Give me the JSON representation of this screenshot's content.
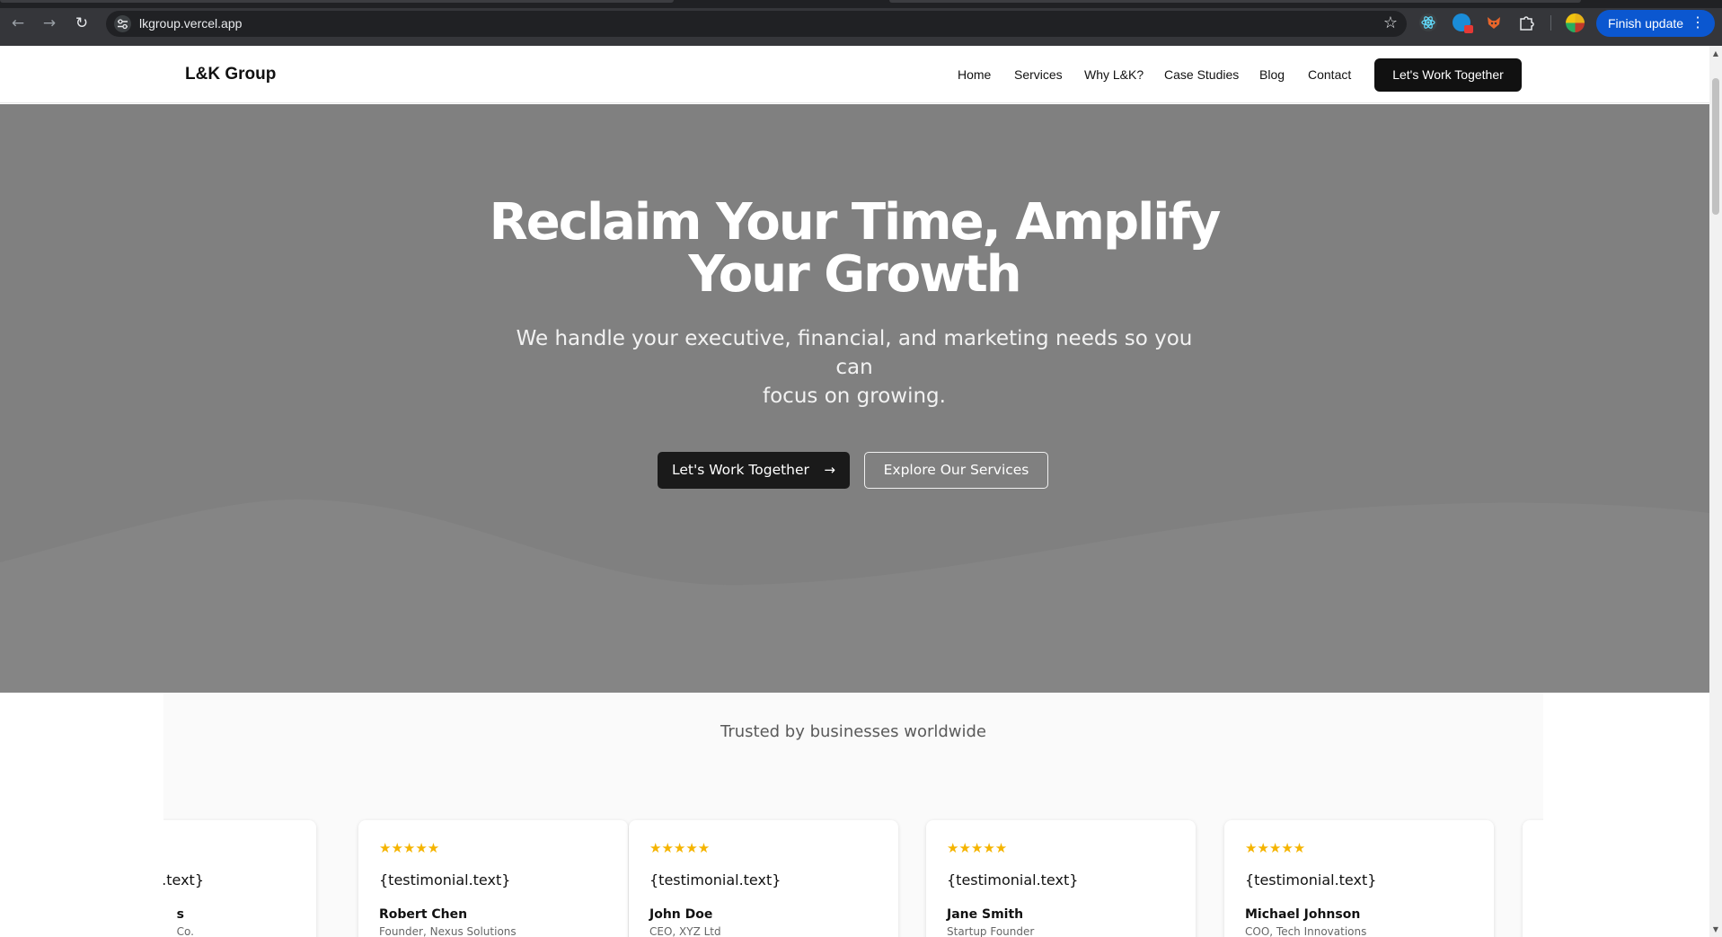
{
  "browser": {
    "url": "lkgroup.vercel.app",
    "update_label": "Finish update",
    "back_icon": "←",
    "forward_icon": "→",
    "reload_icon": "↻",
    "star_icon": "☆",
    "menu_icon": "⋮"
  },
  "site": {
    "brand": "L&K Group",
    "nav": [
      "Home",
      "Services",
      "Why L&K?",
      "Case Studies",
      "Blog",
      "Contact"
    ],
    "header_cta": "Let's Work Together"
  },
  "hero": {
    "title_line1": "Reclaim Your Time, Amplify",
    "title_line2": "Your Growth",
    "subtitle_line1": "We handle your executive, financial, and marketing needs so you can",
    "subtitle_line2": "focus on growing.",
    "primary_cta": "Let's Work Together",
    "primary_arrow": "→",
    "secondary_cta": "Explore Our Services"
  },
  "testimonials": {
    "title": "Trusted by businesses worldwide",
    "stars": "★★★★★",
    "cards": [
      {
        "text": ".text}",
        "name": "s",
        "role": "Co."
      },
      {
        "text": "{testimonial.text}",
        "name": "Robert Chen",
        "role": "Founder, Nexus Solutions"
      },
      {
        "text": "{testimonial.text}",
        "name": "John Doe",
        "role": "CEO, XYZ Ltd"
      },
      {
        "text": "{testimonial.text}",
        "name": "Jane Smith",
        "role": "Startup Founder"
      },
      {
        "text": "{testimonial.text}",
        "name": "Michael Johnson",
        "role": "COO, Tech Innovations"
      },
      {
        "text": "",
        "name": "",
        "role": ""
      }
    ]
  },
  "colors": {
    "hero_bg": "#808080",
    "accent_dark": "#111111",
    "star": "#f5b400",
    "update_button": "#0b57d0"
  }
}
